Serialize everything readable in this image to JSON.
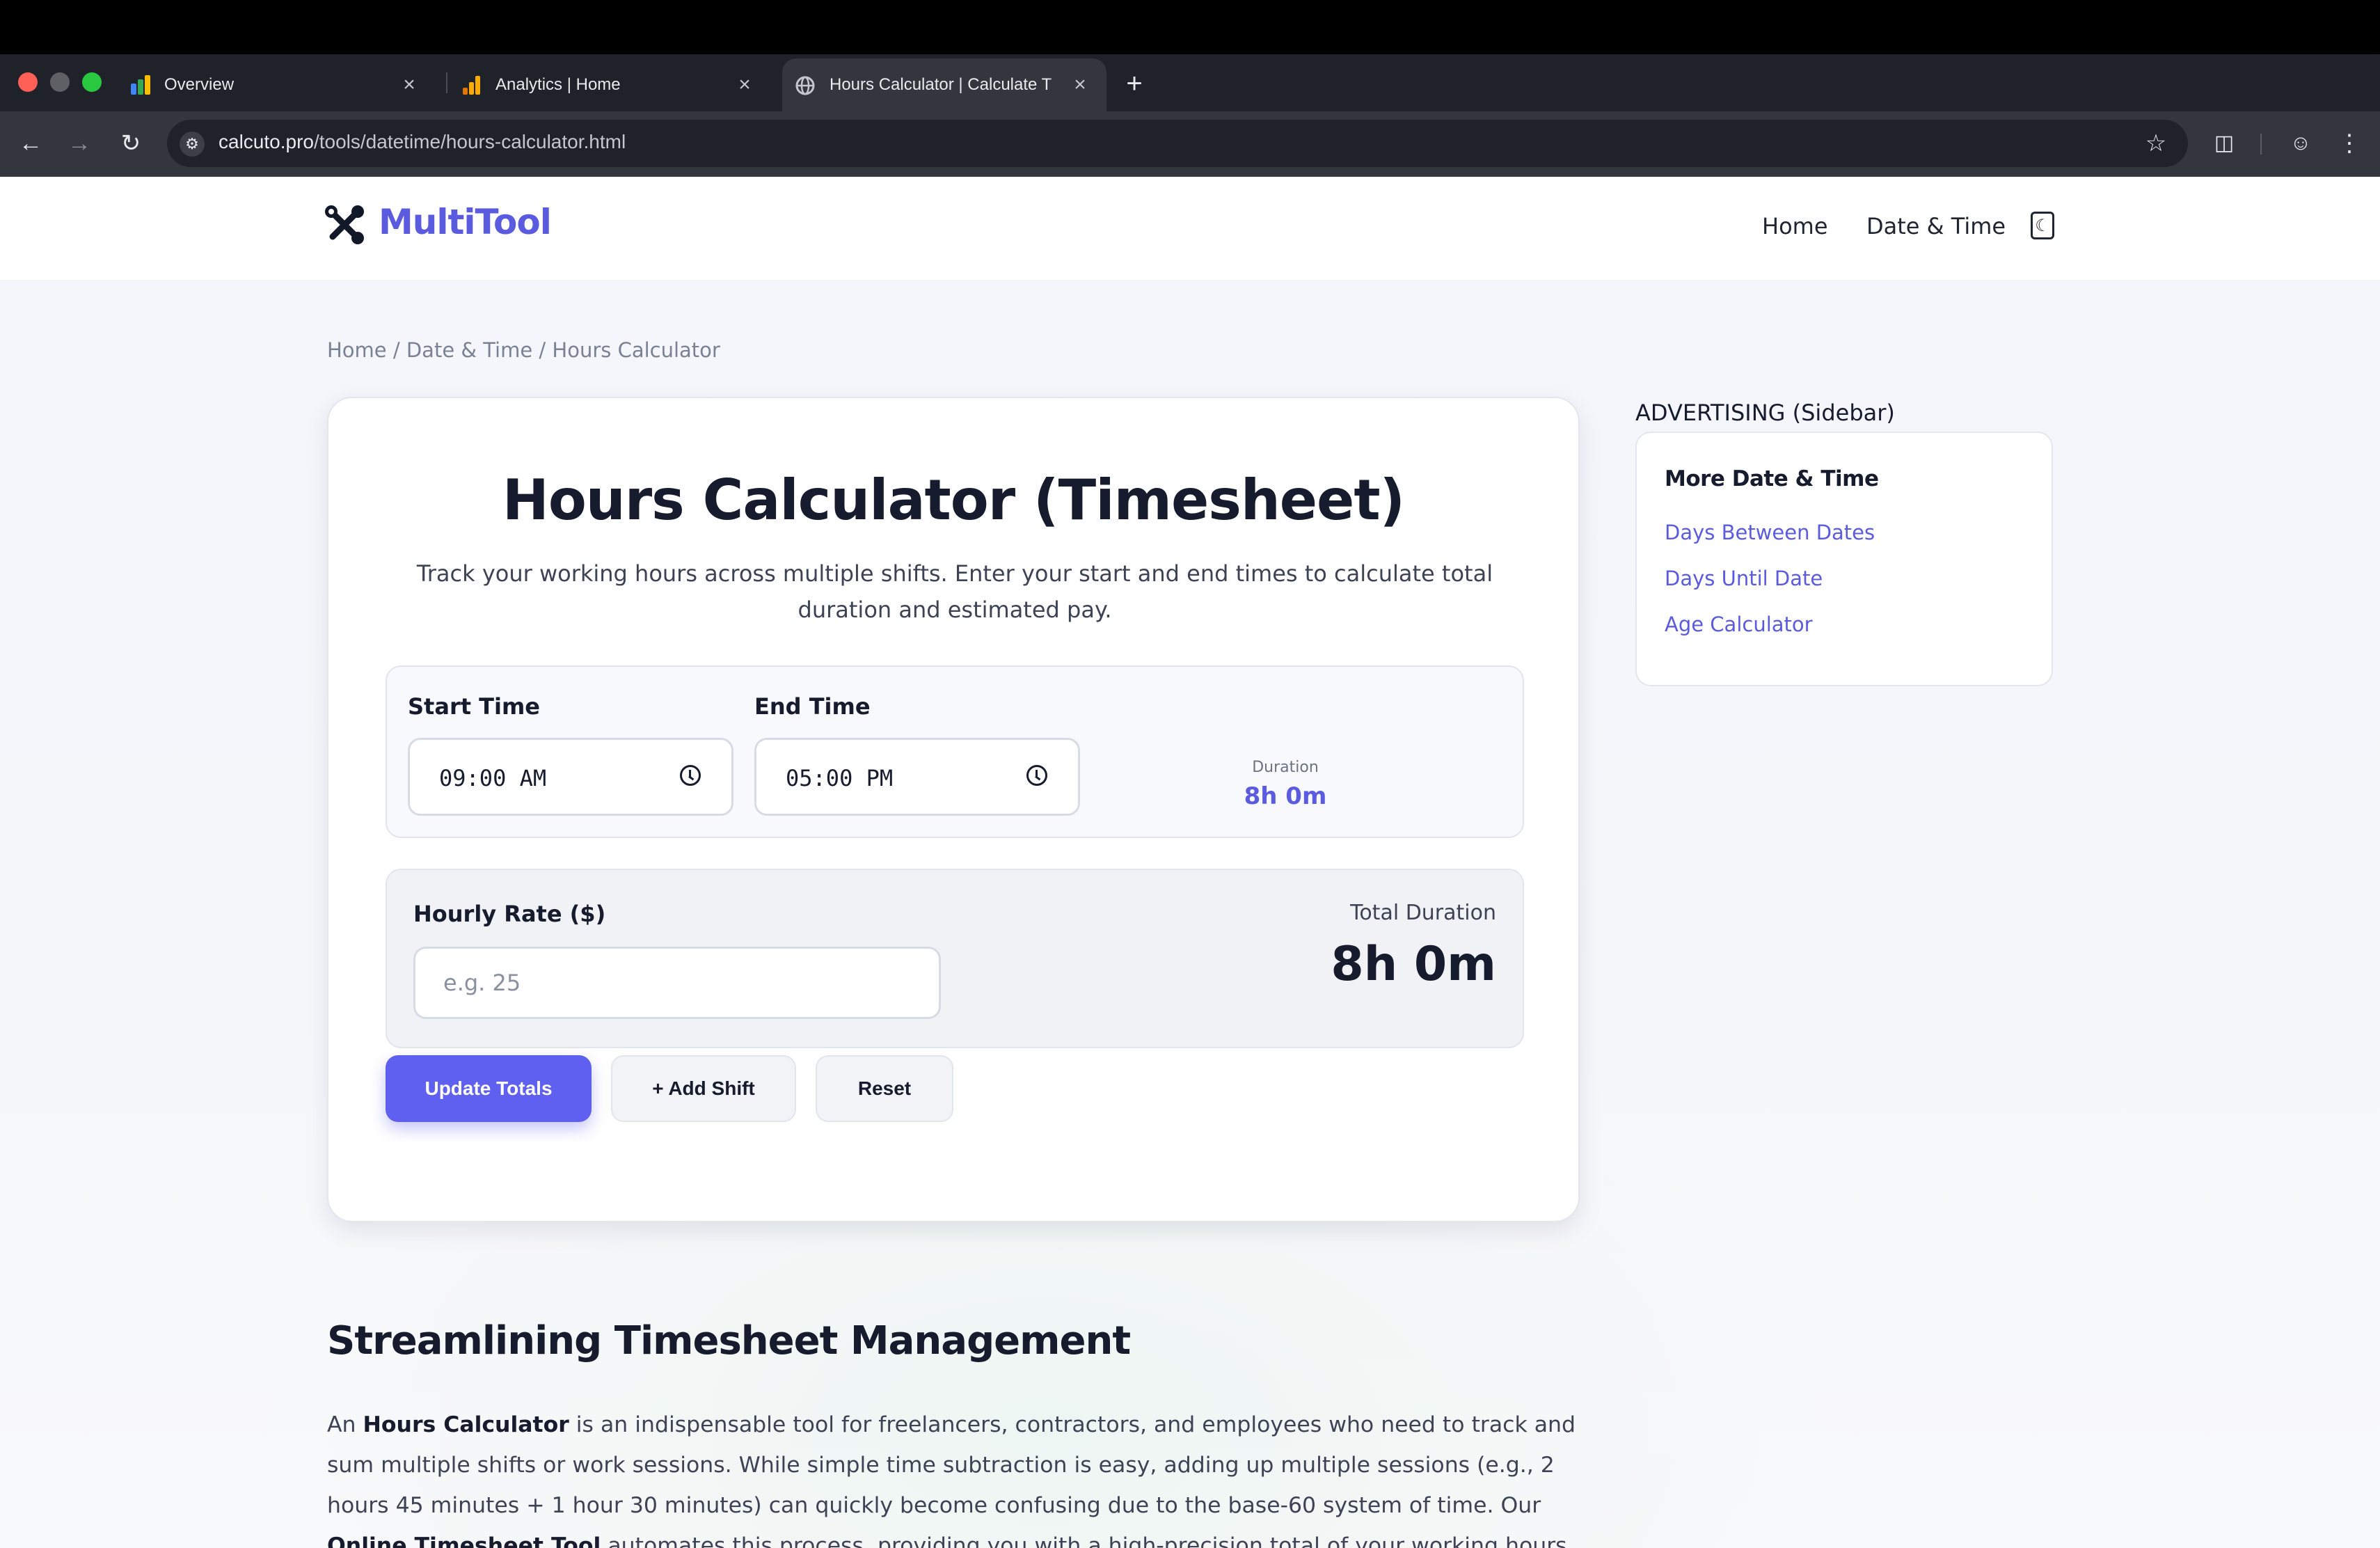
{
  "browser": {
    "tabs": [
      {
        "title": "Overview",
        "close": "×"
      },
      {
        "title": "Analytics | Home",
        "close": "×"
      },
      {
        "title": "Hours Calculator | Calculate T",
        "close": "×"
      }
    ],
    "new_tab": "+",
    "url_host": "calcuto.pro",
    "url_path": "/tools/datetime/hours-calculator.html"
  },
  "site": {
    "logo": "MultiTool",
    "nav": [
      "Home",
      "Date & Time"
    ],
    "accent_color": "#5b5be0"
  },
  "breadcrumb": "Home / Date & Time / Hours Calculator",
  "calculator": {
    "title": "Hours Calculator (Timesheet)",
    "description": "Track your working hours across multiple shifts. Enter your start and end times to calculate total duration and estimated pay.",
    "start_label": "Start Time",
    "start_value": "09:00 AM",
    "end_label": "End Time",
    "end_value": "05:00 PM",
    "duration_label": "Duration",
    "duration_value": "8h 0m",
    "rate_label": "Hourly Rate ($)",
    "rate_placeholder": "e.g. 25",
    "total_label": "Total Duration",
    "total_value": "8h 0m",
    "buttons": {
      "update": "Update Totals",
      "add_shift": "+ Add Shift",
      "reset": "Reset"
    }
  },
  "sidebar": {
    "ad_label": "ADVERTISING (Sidebar)",
    "title": "More Date & Time",
    "links": [
      "Days Between Dates",
      "Days Until Date",
      "Age Calculator"
    ]
  },
  "article": {
    "heading": "Streamlining Timesheet Management",
    "p_intro": "An ",
    "p_bold1": "Hours Calculator",
    "p_mid": " is an indispensable tool for freelancers, contractors, and employees who need to track and sum multiple shifts or work sessions. While simple time subtraction is easy, adding up multiple sessions (e.g., 2 hours 45 minutes + 1 hour 30 minutes) can quickly become confusing due to the base-60 system of time. Our ",
    "p_bold2": "Online Timesheet Tool",
    "p_end": " automates this process, providing you with a high-precision total of your working hours and potential earnings."
  }
}
